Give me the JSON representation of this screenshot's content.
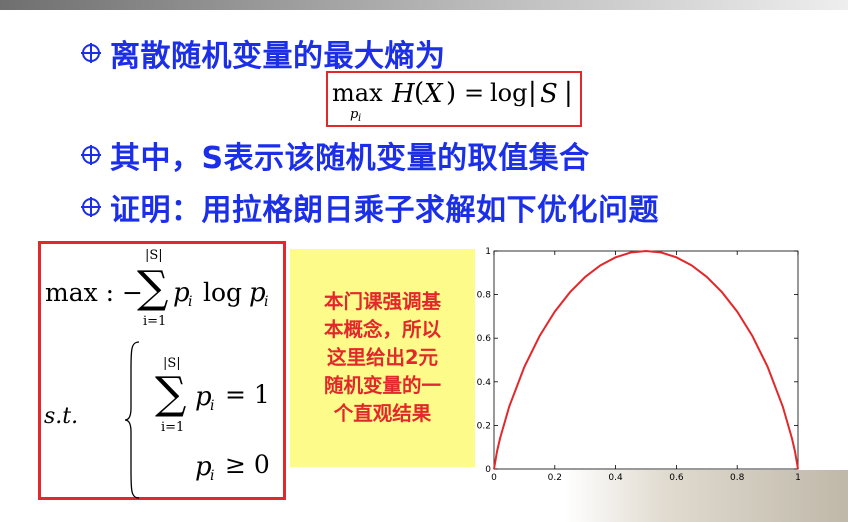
{
  "bullets": [
    "离散随机变量的最大熵为",
    "其中，S表示该随机变量的取值集合",
    "证明：用拉格朗日乘子求解如下优化问题"
  ],
  "formula_top": {
    "max": "max",
    "sub_p": "p",
    "sub_i": "i",
    "H": "H",
    "lparen": "(",
    "X": "X",
    "rparen": ")",
    "eq": "=",
    "log": "log",
    "bar1": "|",
    "S": "S",
    "bar2": "|"
  },
  "optimization": {
    "max_label": "max : −",
    "sum_symbol": "∑",
    "sum_top": "|S|",
    "sum_bottom": "i=1",
    "term_p": "p",
    "term_i": "i",
    "log": "log",
    "term_p2": "p",
    "term_i2": "i",
    "st_label": "s.t.",
    "c1_sum": "∑",
    "c1_top": "|S|",
    "c1_bottom": "i=1",
    "c1_p": "p",
    "c1_i": "i",
    "c1_rhs": "= 1",
    "c2_p": "p",
    "c2_i": "i",
    "c2_rhs": "≥ 0"
  },
  "note": [
    "本门课强调基",
    "本概念，所以",
    "这里给出2元",
    "随机变量的一",
    "个直观结果"
  ],
  "colors": {
    "bullet_text": "#1c2fe8",
    "box_border": "#e3282b",
    "note_bg": "#fdfb8a",
    "note_text": "#e3282b",
    "curve": "#e3282b"
  },
  "chart_data": {
    "type": "line",
    "title": "",
    "xlabel": "",
    "ylabel": "",
    "xlim": [
      0,
      1
    ],
    "ylim": [
      0,
      1
    ],
    "xticks": [
      "0",
      "0.2",
      "0.4",
      "0.6",
      "0.8",
      "1"
    ],
    "yticks": [
      "0",
      "0.2",
      "0.4",
      "0.6",
      "0.8",
      "1"
    ],
    "grid": false,
    "series": [
      {
        "color": "#e3282b",
        "x": [
          0,
          0.01,
          0.02,
          0.05,
          0.1,
          0.15,
          0.2,
          0.25,
          0.3,
          0.35,
          0.4,
          0.45,
          0.5,
          0.55,
          0.6,
          0.65,
          0.7,
          0.75,
          0.8,
          0.85,
          0.9,
          0.95,
          0.98,
          0.99,
          1
        ],
        "y": [
          0,
          0.081,
          0.141,
          0.286,
          0.469,
          0.61,
          0.722,
          0.811,
          0.881,
          0.934,
          0.971,
          0.993,
          1,
          0.993,
          0.971,
          0.934,
          0.881,
          0.811,
          0.722,
          0.61,
          0.469,
          0.286,
          0.141,
          0.081,
          0
        ]
      }
    ]
  }
}
